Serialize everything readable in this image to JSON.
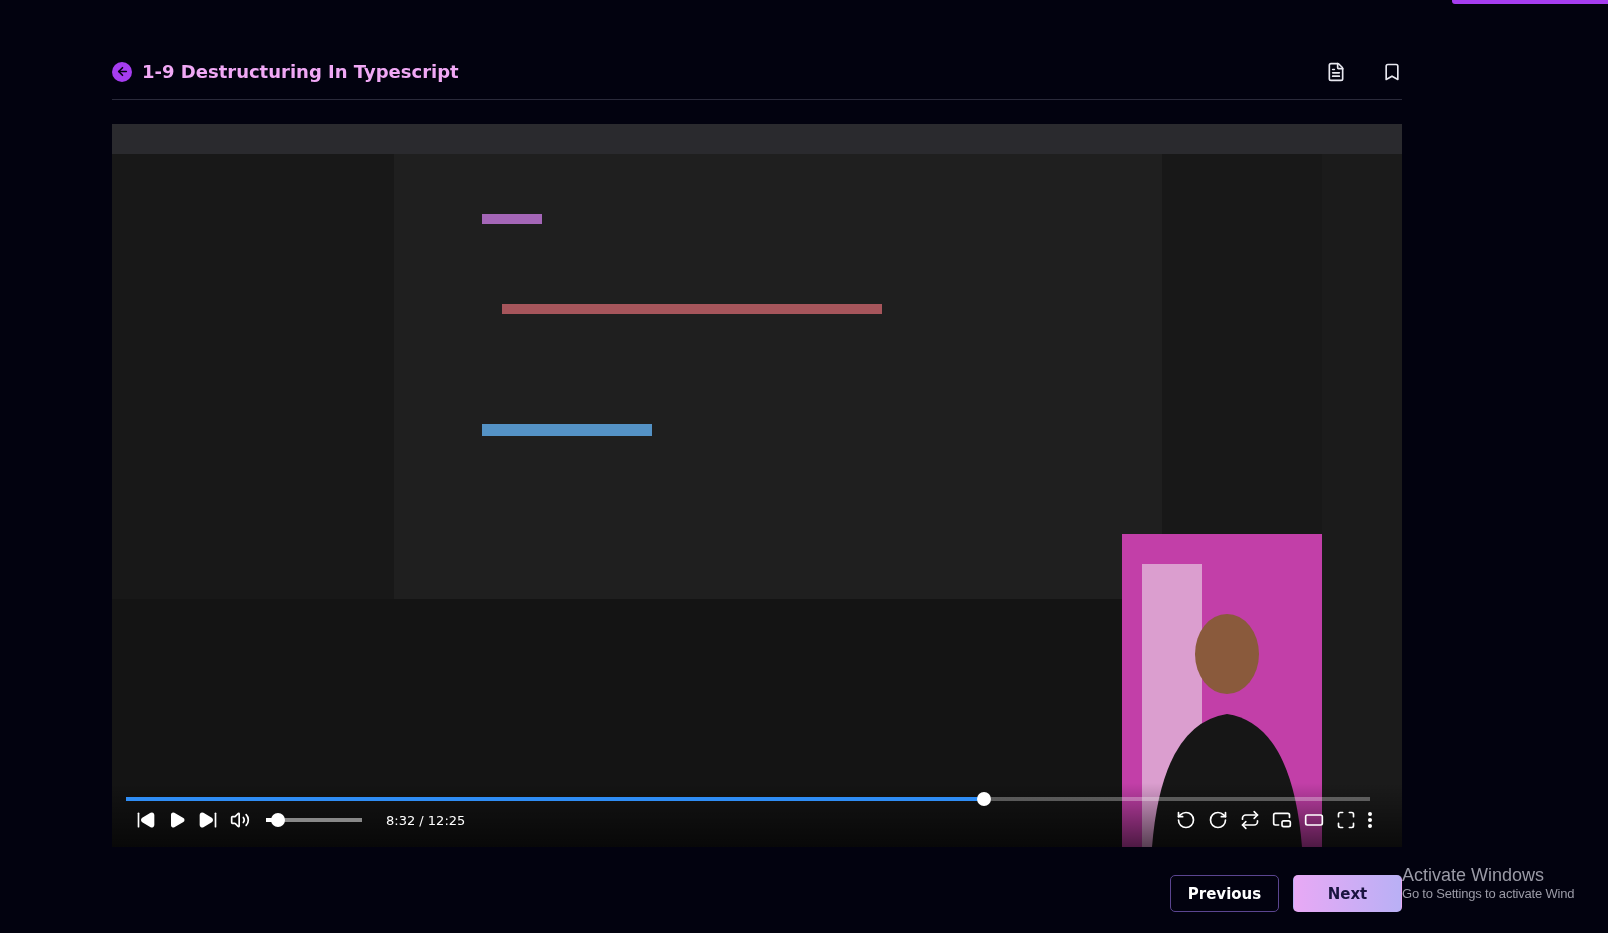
{
  "lesson": {
    "title": "1-9 Destructuring In Typescript"
  },
  "player": {
    "progress": {
      "level": 0.69
    },
    "volume": {
      "level": 0.13
    },
    "time": "8:32 / 12:25"
  },
  "navigation": [
    {
      "label": "Previous",
      "kind": "outline"
    },
    {
      "label": "Next",
      "kind": "filled"
    }
  ],
  "os_watermark": {
    "title": "Activate Windows",
    "subtitle": "Go to Settings to activate Wind"
  }
}
